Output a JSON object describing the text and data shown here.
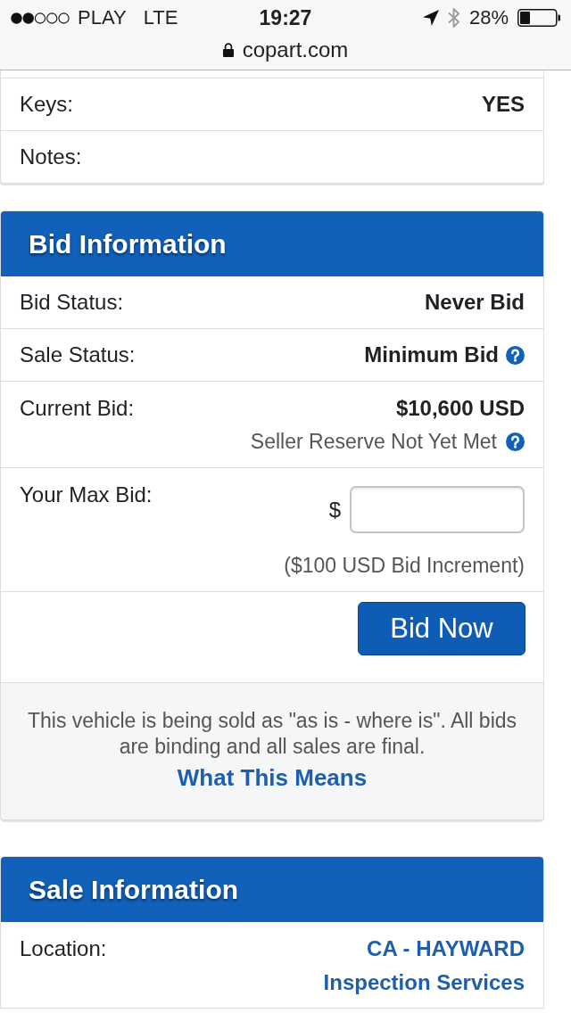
{
  "status_bar": {
    "carrier": "PLAY",
    "network": "LTE",
    "time": "19:27",
    "battery": "28%"
  },
  "address_bar": {
    "url": "copart.com",
    "secure": true
  },
  "vehicle_details": {
    "rows": [
      {
        "label": "Keys:",
        "value": "YES"
      },
      {
        "label": "Notes:"
      }
    ]
  },
  "bid_information": {
    "title": "Bid Information",
    "rows": [
      {
        "label": "Bid Status:",
        "value": "Never Bid"
      },
      {
        "label": "Sale Status:",
        "value": "Minimum Bid",
        "help": true
      },
      {
        "label": "Current Bid:",
        "value": "$10,600 USD",
        "note": "Seller Reserve Not Yet Met",
        "note_help": true
      }
    ],
    "max_bid": {
      "label": "Your Max Bid:",
      "currency": "$",
      "increment": "($100 USD Bid Increment)"
    },
    "submit_button": "Bid Now",
    "notice": {
      "text": "This vehicle is being sold as \"as is - where is\". All bids are binding and all sales are final.",
      "link": "What This Means"
    }
  },
  "sale_information": {
    "title": "Sale Information",
    "rows": [
      {
        "label": "Location:",
        "links": [
          "CA - HAYWARD",
          "Inspection Services"
        ]
      }
    ]
  }
}
